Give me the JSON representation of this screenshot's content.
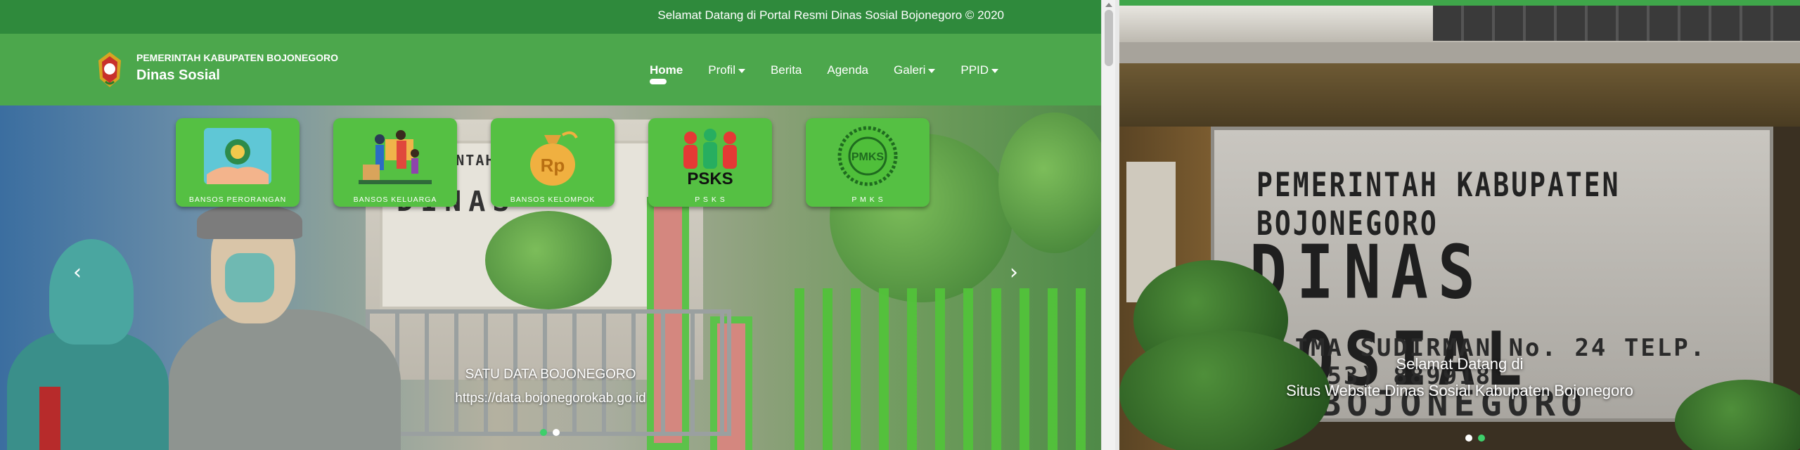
{
  "header": {
    "welcome": "Selamat Datang di Portal Resmi Dinas Sosial Bojonegoro © 2020"
  },
  "brand": {
    "top": "PEMERINTAH KABUPATEN BOJONEGORO",
    "main": "Dinas Sosial"
  },
  "nav": {
    "items": [
      {
        "label": "Home"
      },
      {
        "label": "Profil"
      },
      {
        "label": "Berita"
      },
      {
        "label": "Agenda"
      },
      {
        "label": "Galeri"
      },
      {
        "label": "PPID"
      }
    ]
  },
  "tiles": [
    {
      "label": "BANSOS PERORANGAN"
    },
    {
      "label": "BANSOS KELUARGA"
    },
    {
      "label": "BANSOS KELOMPOK",
      "art_text": "Rp"
    },
    {
      "label": "P S K S",
      "art_text": "PSKS"
    },
    {
      "label": "P M K S",
      "art_text": "PMKS"
    }
  ],
  "left_slide": {
    "sign_line1": "PEMERINTAH KAB",
    "sign_line2": "DINAS",
    "caption_title": "SATU DATA BOJONEGORO",
    "caption_url": "https://data.bojonegorokab.go.id",
    "prev": "‹",
    "next": "›"
  },
  "right_slide": {
    "sign_line1": "PEMERINTAH KABUPATEN BOJONEGORO",
    "sign_line2": "DINAS SOSIAL",
    "sign_line3": "LIMA SUDIRMAN No. 24 TELP. (0353) 889918",
    "sign_line4": "BOJONEGORO",
    "caption_line1": "Selamat Datang di",
    "caption_line2": "Situs Website Dinas Sosial Kabupaten Bojonegoro"
  },
  "colors": {
    "topbar": "#2f8a3c",
    "navbar": "#4ca74c",
    "tile": "#55c043",
    "active_dot": "#3ecf6b"
  }
}
